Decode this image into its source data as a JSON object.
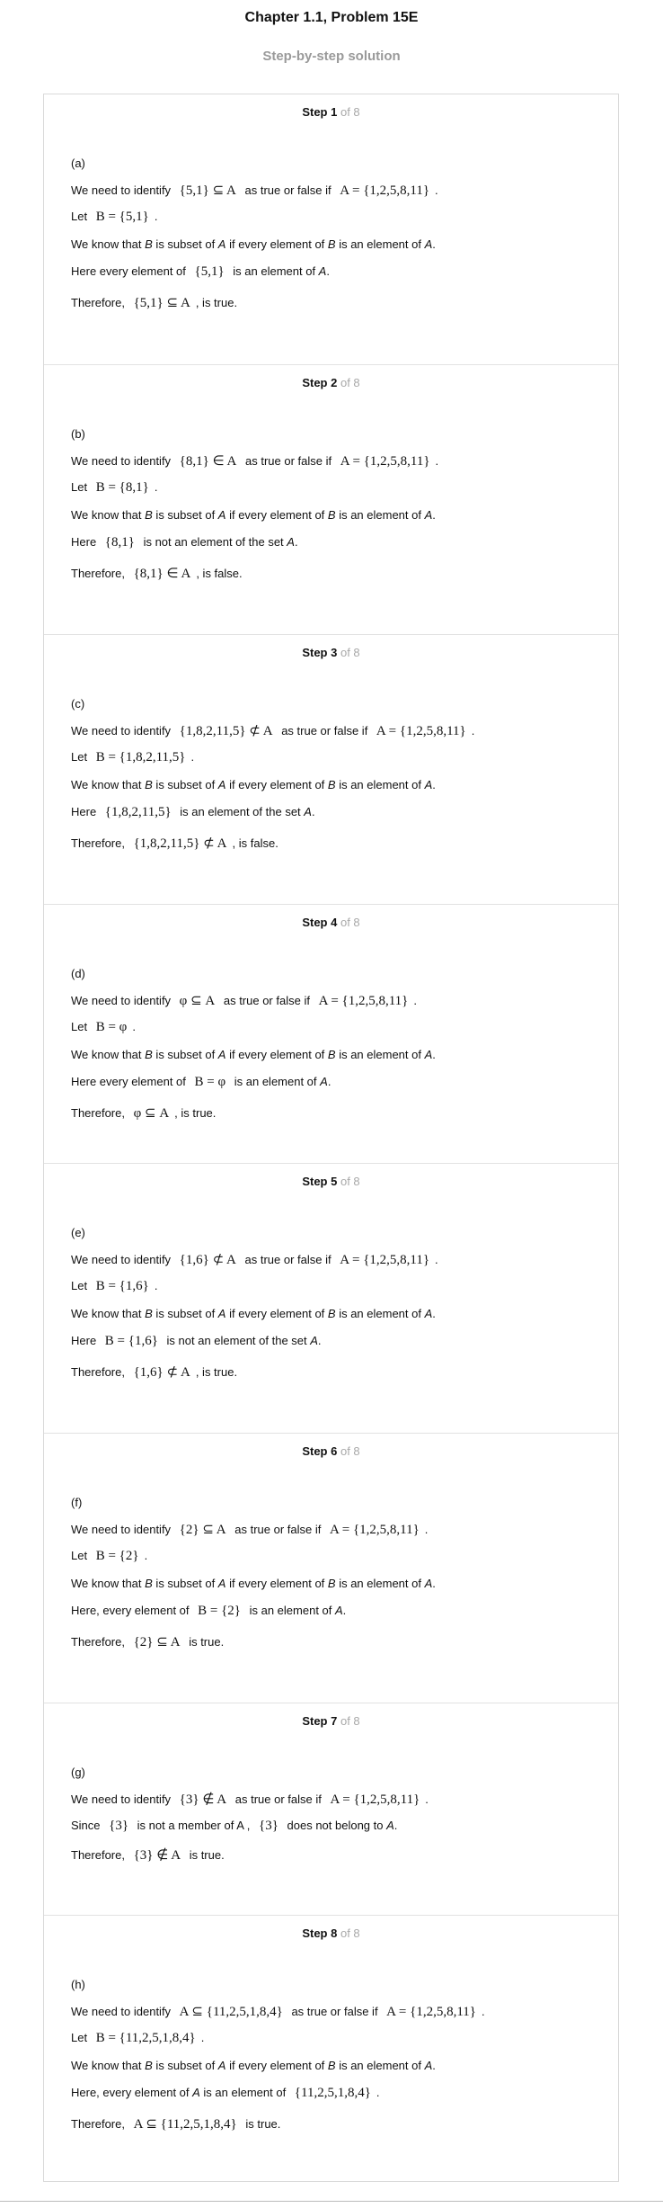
{
  "header": {
    "title": "Chapter 1.1, Problem 15E",
    "subtitle": "Step-by-step solution"
  },
  "step_word": "Step",
  "of_text": "of 8",
  "steps": [
    {
      "number": "1",
      "lines": [
        {
          "segments": [
            {
              "t": "(a)"
            }
          ]
        },
        {
          "segments": [
            {
              "t": "We need to identify "
            },
            {
              "m": "{5,1} ⊆ A"
            },
            {
              "t": " as true or false if "
            },
            {
              "m": "A = {1,2,5,8,11}"
            },
            {
              "t": "."
            }
          ]
        },
        {
          "segments": [
            {
              "t": "Let "
            },
            {
              "m": "B = {5,1}"
            },
            {
              "t": "."
            }
          ]
        },
        {
          "segments": [
            {
              "t": "We know that "
            },
            {
              "i": "B"
            },
            {
              "t": " is subset of "
            },
            {
              "i": "A"
            },
            {
              "t": " if every element of "
            },
            {
              "i": "B"
            },
            {
              "t": " is an element of "
            },
            {
              "i": "A"
            },
            {
              "t": "."
            }
          ]
        },
        {
          "segments": [
            {
              "t": "Here every element of "
            },
            {
              "m": "{5,1}"
            },
            {
              "t": " is an element of "
            },
            {
              "i": "A"
            },
            {
              "t": "."
            }
          ]
        },
        {
          "segments": [
            {
              "t": "Therefore, "
            },
            {
              "m": "{5,1} ⊆ A"
            },
            {
              "t": ", is true."
            }
          ]
        }
      ]
    },
    {
      "number": "2",
      "lines": [
        {
          "segments": [
            {
              "t": "(b)"
            }
          ]
        },
        {
          "segments": [
            {
              "t": "We need to identify "
            },
            {
              "m": "{8,1} ∈ A"
            },
            {
              "t": " as true or false if "
            },
            {
              "m": "A = {1,2,5,8,11}"
            },
            {
              "t": "."
            }
          ]
        },
        {
          "segments": [
            {
              "t": "Let "
            },
            {
              "m": "B = {8,1}"
            },
            {
              "t": "."
            }
          ]
        },
        {
          "segments": [
            {
              "t": "We know that "
            },
            {
              "i": "B"
            },
            {
              "t": " is subset of "
            },
            {
              "i": "A"
            },
            {
              "t": " if every element of "
            },
            {
              "i": "B"
            },
            {
              "t": " is an element of "
            },
            {
              "i": "A"
            },
            {
              "t": "."
            }
          ]
        },
        {
          "segments": [
            {
              "t": "Here "
            },
            {
              "m": "{8,1}"
            },
            {
              "t": " is not an element of the set "
            },
            {
              "i": "A"
            },
            {
              "t": "."
            }
          ]
        },
        {
          "segments": [
            {
              "t": "Therefore, "
            },
            {
              "m": "{8,1} ∈ A"
            },
            {
              "t": ", is false."
            }
          ]
        }
      ]
    },
    {
      "number": "3",
      "lines": [
        {
          "segments": [
            {
              "t": "(c)"
            }
          ]
        },
        {
          "segments": [
            {
              "t": "We need to identify "
            },
            {
              "m": "{1,8,2,11,5} ⊄ A"
            },
            {
              "t": " as true or false if "
            },
            {
              "m": "A = {1,2,5,8,11}"
            },
            {
              "t": "."
            }
          ]
        },
        {
          "segments": [
            {
              "t": "Let "
            },
            {
              "m": "B = {1,8,2,11,5}"
            },
            {
              "t": "."
            }
          ]
        },
        {
          "segments": [
            {
              "t": "We know that "
            },
            {
              "i": "B"
            },
            {
              "t": " is subset of "
            },
            {
              "i": "A"
            },
            {
              "t": " if every element of "
            },
            {
              "i": "B"
            },
            {
              "t": " is an element of "
            },
            {
              "i": "A"
            },
            {
              "t": "."
            }
          ]
        },
        {
          "segments": [
            {
              "t": "Here "
            },
            {
              "m": "{1,8,2,11,5}"
            },
            {
              "t": " is an element of the set "
            },
            {
              "i": "A"
            },
            {
              "t": "."
            }
          ]
        },
        {
          "segments": [
            {
              "t": "Therefore, "
            },
            {
              "m": "{1,8,2,11,5} ⊄ A"
            },
            {
              "t": ", is false."
            }
          ]
        }
      ]
    },
    {
      "number": "4",
      "lines": [
        {
          "segments": [
            {
              "t": "(d)"
            }
          ]
        },
        {
          "segments": [
            {
              "t": "We need to identify "
            },
            {
              "m": "φ ⊆ A"
            },
            {
              "t": " as true or false if "
            },
            {
              "m": "A = {1,2,5,8,11}"
            },
            {
              "t": "."
            }
          ]
        },
        {
          "segments": [
            {
              "t": "Let "
            },
            {
              "m": "B = φ"
            },
            {
              "t": "."
            }
          ]
        },
        {
          "segments": [
            {
              "t": "We know that "
            },
            {
              "i": "B"
            },
            {
              "t": " is subset of "
            },
            {
              "i": "A"
            },
            {
              "t": " if every element of "
            },
            {
              "i": "B"
            },
            {
              "t": " is an element of "
            },
            {
              "i": "A"
            },
            {
              "t": "."
            }
          ]
        },
        {
          "segments": [
            {
              "t": "Here every element of "
            },
            {
              "m": "B = φ"
            },
            {
              "t": " is an element of "
            },
            {
              "i": "A"
            },
            {
              "t": "."
            }
          ]
        },
        {
          "segments": [
            {
              "t": "Therefore, "
            },
            {
              "m": "φ ⊆ A"
            },
            {
              "t": ", is true."
            }
          ]
        }
      ]
    },
    {
      "number": "5",
      "lines": [
        {
          "segments": [
            {
              "t": "(e)"
            }
          ]
        },
        {
          "segments": [
            {
              "t": "We need to identify "
            },
            {
              "m": "{1,6} ⊄ A"
            },
            {
              "t": " as true or false if "
            },
            {
              "m": "A = {1,2,5,8,11}"
            },
            {
              "t": "."
            }
          ]
        },
        {
          "segments": [
            {
              "t": "Let "
            },
            {
              "m": "B = {1,6}"
            },
            {
              "t": "."
            }
          ]
        },
        {
          "segments": [
            {
              "t": "We know that "
            },
            {
              "i": "B"
            },
            {
              "t": " is subset of "
            },
            {
              "i": "A"
            },
            {
              "t": " if every element of "
            },
            {
              "i": "B"
            },
            {
              "t": " is an element of "
            },
            {
              "i": "A"
            },
            {
              "t": "."
            }
          ]
        },
        {
          "segments": [
            {
              "t": "Here "
            },
            {
              "m": "B = {1,6}"
            },
            {
              "t": " is not an element of the set "
            },
            {
              "i": "A"
            },
            {
              "t": "."
            }
          ]
        },
        {
          "segments": [
            {
              "t": "Therefore, "
            },
            {
              "m": "{1,6} ⊄ A"
            },
            {
              "t": ", is true."
            }
          ]
        }
      ]
    },
    {
      "number": "6",
      "lines": [
        {
          "segments": [
            {
              "t": "(f)"
            }
          ]
        },
        {
          "segments": [
            {
              "t": "We need to identify "
            },
            {
              "m": "{2} ⊆ A"
            },
            {
              "t": " as true or false if "
            },
            {
              "m": "A = {1,2,5,8,11}"
            },
            {
              "t": "."
            }
          ]
        },
        {
          "segments": [
            {
              "t": "Let "
            },
            {
              "m": "B = {2}"
            },
            {
              "t": "."
            }
          ]
        },
        {
          "segments": [
            {
              "t": "We know that "
            },
            {
              "i": "B"
            },
            {
              "t": " is subset of "
            },
            {
              "i": "A"
            },
            {
              "t": " if every element of "
            },
            {
              "i": "B"
            },
            {
              "t": " is an element of "
            },
            {
              "i": "A"
            },
            {
              "t": "."
            }
          ]
        },
        {
          "segments": [
            {
              "t": "Here, every element of "
            },
            {
              "m": "B = {2}"
            },
            {
              "t": " is an element of "
            },
            {
              "i": "A"
            },
            {
              "t": "."
            }
          ]
        },
        {
          "segments": [
            {
              "t": "Therefore, "
            },
            {
              "m": "{2} ⊆ A"
            },
            {
              "t": " is true."
            }
          ]
        }
      ]
    },
    {
      "number": "7",
      "lines": [
        {
          "segments": [
            {
              "t": "(g)"
            }
          ]
        },
        {
          "segments": [
            {
              "t": "We need to identify "
            },
            {
              "m": "{3} ∉ A"
            },
            {
              "t": " as true or false if "
            },
            {
              "m": "A = {1,2,5,8,11}"
            },
            {
              "t": "."
            }
          ]
        },
        {
          "segments": [
            {
              "t": "Since "
            },
            {
              "m": "{3}"
            },
            {
              "t": " is not a member of A , "
            },
            {
              "m": "{3}"
            },
            {
              "t": " does not belong to "
            },
            {
              "i": "A"
            },
            {
              "t": "."
            }
          ]
        },
        {
          "segments": [
            {
              "t": "Therefore, "
            },
            {
              "m": "{3} ∉ A"
            },
            {
              "t": " is true."
            }
          ]
        }
      ]
    },
    {
      "number": "8",
      "lines": [
        {
          "segments": [
            {
              "t": "(h)"
            }
          ]
        },
        {
          "segments": [
            {
              "t": "We need to identify "
            },
            {
              "m": "A ⊆ {11,2,5,1,8,4}"
            },
            {
              "t": " as true or false if "
            },
            {
              "m": "A = {1,2,5,8,11}"
            },
            {
              "t": "."
            }
          ]
        },
        {
          "segments": [
            {
              "t": "Let "
            },
            {
              "m": "B = {11,2,5,1,8,4}"
            },
            {
              "t": "."
            }
          ]
        },
        {
          "segments": [
            {
              "t": "We know that "
            },
            {
              "i": "B"
            },
            {
              "t": " is subset of "
            },
            {
              "i": "A"
            },
            {
              "t": " if every element of "
            },
            {
              "i": "B"
            },
            {
              "t": " is an element of "
            },
            {
              "i": "A"
            },
            {
              "t": "."
            }
          ]
        },
        {
          "segments": [
            {
              "t": "Here, every element of "
            },
            {
              "i": "A"
            },
            {
              "t": " is an element of "
            },
            {
              "m": "{11,2,5,1,8,4}"
            },
            {
              "t": "."
            }
          ]
        },
        {
          "segments": [
            {
              "t": "Therefore, "
            },
            {
              "m": "A ⊆ {11,2,5,1,8,4}"
            },
            {
              "t": " is true."
            }
          ]
        }
      ]
    }
  ]
}
